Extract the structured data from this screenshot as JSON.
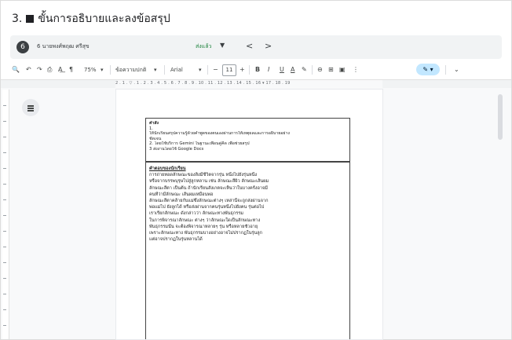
{
  "heading": {
    "number": "3.",
    "title": "ขั้นการอธิบายและลงข้อสรุป"
  },
  "assignment": {
    "badge": "6",
    "student": "6 นายพงศ์พฤฒ ศรีสุข",
    "status": "ส่งแล้ว",
    "dropdown": "▼",
    "prev": "<",
    "next": ">"
  },
  "toolbar": {
    "search": "🔍",
    "undo": "↶",
    "redo": "↷",
    "print": "⎙",
    "spell": "A͟",
    "paint": "¶",
    "zoom": "75%",
    "zoom_caret": "▾",
    "style": "ข้อความปกติ",
    "style_caret": "▾",
    "font": "Arial",
    "font_caret": "▾",
    "minus": "−",
    "font_size": "11",
    "plus": "+",
    "bold": "B",
    "italic": "I",
    "underline": "U",
    "text_color": "A",
    "highlight": "✎",
    "link": "⊖",
    "comment": "⊞",
    "image": "▣",
    "more": "⋮",
    "mode": "✎ ▾",
    "collapse": "⌄"
  },
  "ruler": {
    "marks": "2 . 1 . ▽ . 1 . 2 . 3 . 4 . 5 . 6 . 7 . 8 . 9 . 10 . 11 . 12 . 13 . 14 . 15 . 16 ▾ 17 . 18 . 19"
  },
  "document": {
    "box1": {
      "title": "คำสั่ง",
      "lines": [
        "1.",
        "ให้นักเรียนสรุปความรู้ด้วยคำพูดของตนเองผ่านการให้เหตุผลและการอธิบายอย่าง",
        "ชัดเจน",
        "2. โดยใช้บริการ Gemini ในฐานะเพื่อนคู่คิด เพื่อช่วยสรุป",
        "3 ส่งงานโดยใช้ Google Docs"
      ]
    },
    "box2": {
      "title": "คำตอบของนักเรียน",
      "lines": [
        "การถ่ายทอดลักษณะของสิ่งมีชีวิตจากรุ่น หนึ่งไปยังรุ่นหนึ่ง",
        "หรือจากบรรพบุรุษไปสู่ลูกหลาน เช่น ลักษณะสีผิว ลักษณะเส้นผม",
        "ลักษณะสีตา เป็นต้น ถ้านักเรียนสังเกตจะเห็นว่าในบางครั้งอาจมี",
        "คนที่ว่ามีลักษณะ เส้นผมเหมือนพ่อ",
        "ลักษณะสีตาคล้ายกับแม่ซึ่งลักษณะต่างๆ เหล่านี้จะถูกส่งผ่านจาก",
        "พ่อแม่ไป ยังลูกได้ หรือส่งผ่านจากคนรุ่นหนึ่งไปยังคน รุ่นต่อไป",
        "เราเรียกลักษณะ ดังกล่าวว่า ลักษณะทางพันธุกรรม",
        "ในการพิจารณาลักษณะ ต่างๆ ว่าลักษณะใดเป็นลักษณะทาง",
        "พันธุกรรมนั้น จะต้องพิจารณาหลายๆ รุ่น หรือหลายชั่วอายุ",
        "เพราะลักษณะทาง พันธุกรรมบางอย่างอาจไม่ปรากฏในรุ่นลูก",
        "แต่อาจปรากฏในรุ่นหลานได้"
      ]
    }
  }
}
